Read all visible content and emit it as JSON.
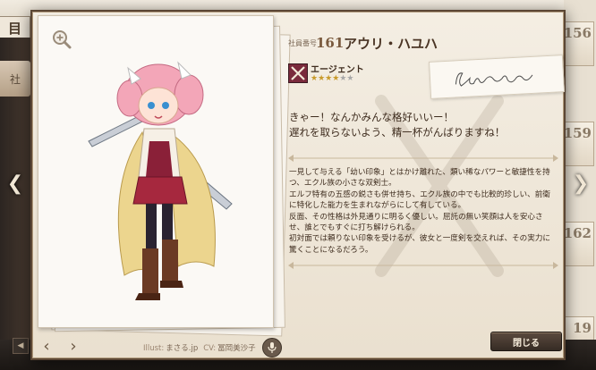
{
  "background": {
    "top_tab_label": "目",
    "side_tab_label": "社",
    "side_card_numbers": [
      "156",
      "159",
      "162"
    ],
    "bottom_left_number": "19"
  },
  "card": {
    "staff_number_label": "社員番号",
    "staff_number": "161",
    "name": "アウリ・ハユハ",
    "class_name": "エージェント",
    "rarity_filled": 4,
    "rarity_total": 6,
    "quote": [
      "きゃー！なんかみんな格好いいー！",
      "遅れを取らないよう、精一杯がんばりますね！"
    ],
    "profile": [
      "一見して与える「幼い印象」とはかけ離れた、類い稀なパワーと敏捷性を持つ、エクル族の小さな双剣士。",
      "エルフ特有の五感の鋭さも併せ持ち、エクル族の中でも比較的珍しい、前衛に特化した能力を生まれながらにして有している。",
      "反面、その性格は外見通りに明るく優しい。屈託の無い笑顔は人を安心させ、誰とでもすぐに打ち解けられる。",
      "初対面では頼りない印象を受けるが、彼女と一度剣を交えれば、その実力に驚くことになるだろう。"
    ],
    "illust_label": "Illust:",
    "illust_name": "まさる.jp",
    "cv_label": "CV:",
    "cv_name": "冨岡美沙子",
    "close_label": "閉じる"
  },
  "icons": {
    "zoom": "magnifier-plus-icon",
    "voice": "microphone-icon",
    "class": "crossed-swords-icon",
    "prev": "chevron-left-icon",
    "next": "chevron-right-icon"
  }
}
